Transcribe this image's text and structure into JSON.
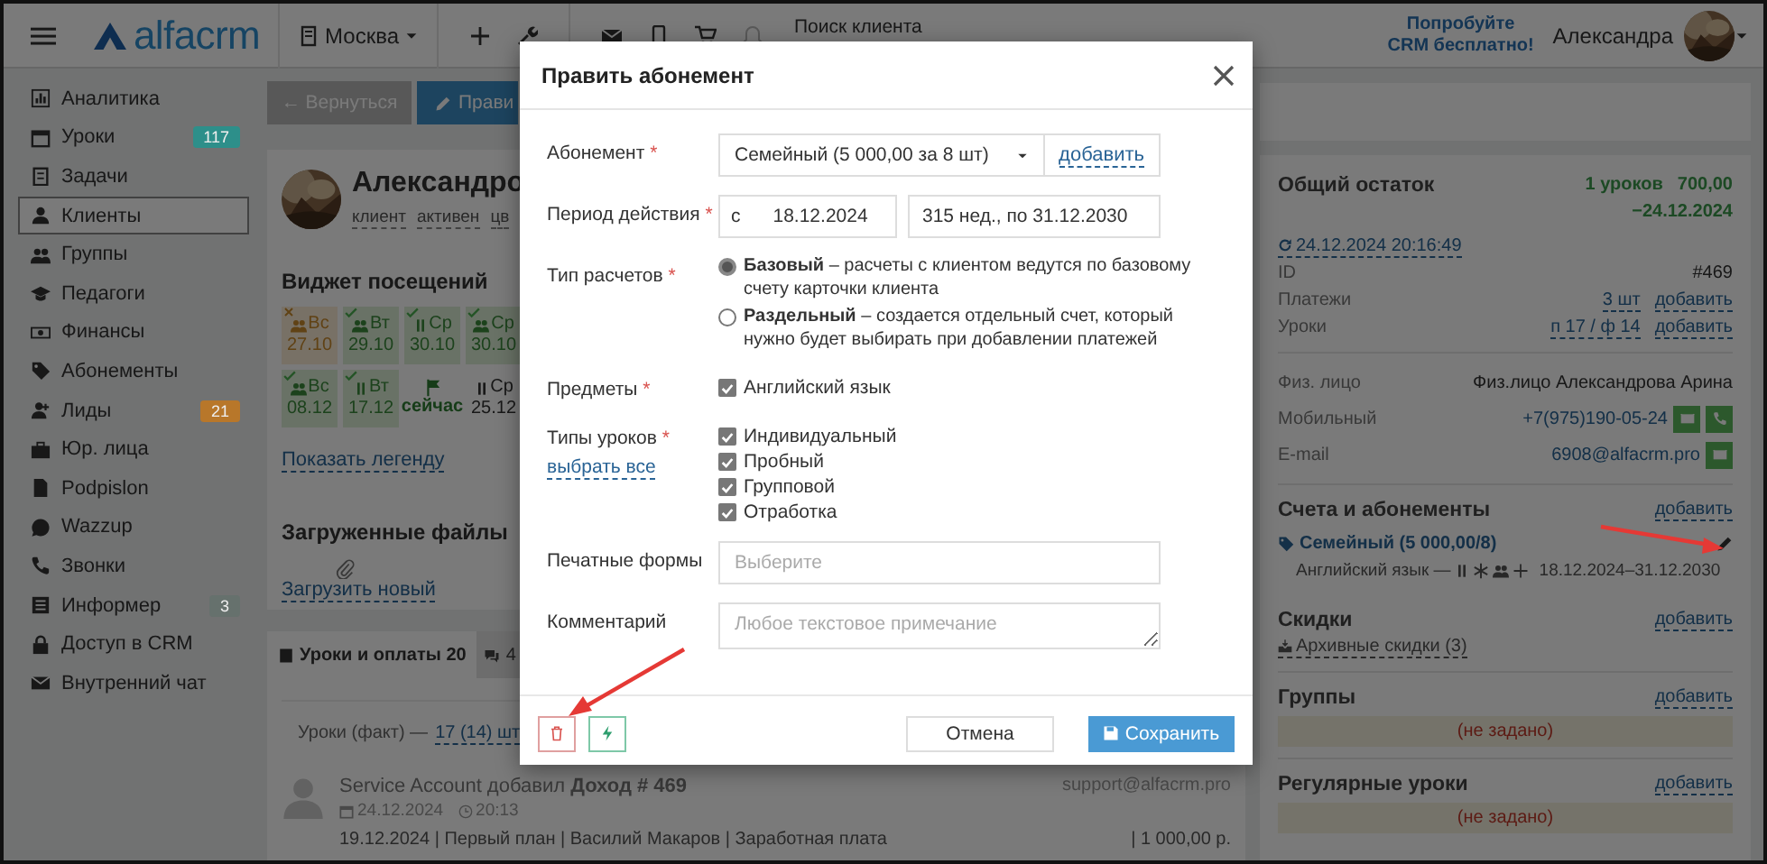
{
  "header": {
    "logo": "alfacrm",
    "city": "Москва",
    "search": {
      "placeholder": "Поиск клиента"
    },
    "promo": "Попробуйте CRM бесплатно!",
    "user": "Александра"
  },
  "sidebar": [
    {
      "label": "Аналитика",
      "selected": false
    },
    {
      "label": "Уроки",
      "selected": false,
      "badge": "117",
      "color": "#2d8f8a"
    },
    {
      "label": "Задачи",
      "selected": false
    },
    {
      "label": "Клиенты",
      "selected": true
    },
    {
      "label": "Группы",
      "selected": false
    },
    {
      "label": "Педагоги",
      "selected": false
    },
    {
      "label": "Финансы",
      "selected": false
    },
    {
      "label": "Абонементы",
      "selected": false
    },
    {
      "label": "Лиды",
      "selected": false,
      "badge": "21",
      "color": "#b8772a"
    },
    {
      "label": "Юр. лица",
      "selected": false
    },
    {
      "label": "Podpislon",
      "selected": false
    },
    {
      "label": "Wazzup",
      "selected": false
    },
    {
      "label": "Звонки",
      "selected": false
    },
    {
      "label": "Информер",
      "selected": false,
      "badge": "3",
      "color": "#66716d"
    },
    {
      "label": "Доступ в CRM",
      "selected": false
    },
    {
      "label": "Внутренний чат",
      "selected": false
    }
  ],
  "toolbar": {
    "back": "← Вернуться",
    "edit": "Прави"
  },
  "client": {
    "name": "Александро",
    "tags": [
      "клиент",
      "активен",
      "цв"
    ]
  },
  "visits": {
    "title": "Виджет посещений",
    "legend": "Показать легенду",
    "cells": [
      {
        "kind": "missed",
        "group": true,
        "day": "Вс",
        "date": "27.10"
      },
      {
        "kind": "done",
        "group": true,
        "day": "Вт",
        "date": "29.10"
      },
      {
        "kind": "done",
        "group": false,
        "day": "Ср",
        "date": "30.10"
      },
      {
        "kind": "done",
        "group": true,
        "day": "Ср",
        "date": "30.10"
      },
      {
        "kind": "done",
        "group": true,
        "day": "Вс",
        "date": "08.12"
      },
      {
        "kind": "done",
        "group": false,
        "day": "Вт",
        "date": "17.12"
      },
      {
        "kind": "now",
        "label": "сейчас"
      },
      {
        "kind": "planned",
        "group": false,
        "day": "Ср",
        "date": "25.12"
      }
    ]
  },
  "files": {
    "title": "Загруженные файлы",
    "upload": "Загрузить новый"
  },
  "tabs": [
    {
      "label": "Уроки и оплаты 20",
      "selected": true
    },
    {
      "label": "4",
      "selected": false
    }
  ],
  "lessons_summary": {
    "label": "Уроки (факт) —",
    "value": "17 (14) шт"
  },
  "feed": [
    {
      "text": "Service Account добавил **Доход # 469**",
      "date": "24.12.2024",
      "time": "20:13",
      "email": "support@alfacrm.pro",
      "details": "19.12.2024 | Первый план | Василий Макаров | Заработная плата",
      "amount": "| 1 000,00 р."
    }
  ],
  "balance": {
    "title": "Общий остаток",
    "lessons": "1 уроков",
    "amount": "700,00",
    "until": "−24.12.2024",
    "synced": "24.12.2024 20:16:49",
    "rows": [
      {
        "label": "ID",
        "value": "#469",
        "link": false
      },
      {
        "label": "Платежи",
        "value": "3 шт",
        "link": true,
        "action": "добавить"
      },
      {
        "label": "Уроки",
        "value": "п 17 / ф 14",
        "link": true,
        "action": "добавить"
      }
    ],
    "contacts": [
      {
        "kind": "text",
        "label": "Физ. лицо",
        "value": "Физ.лицо Александрова Арина"
      },
      {
        "kind": "phone",
        "label": "Мобильный",
        "value": "+7(975)190-05-24"
      },
      {
        "kind": "email",
        "label": "E-mail",
        "value": "6908@alfacrm.pro"
      }
    ]
  },
  "accounts": {
    "title": "Счета и абонементы",
    "action": "добавить",
    "items": [
      {
        "name": "Семейный (5 000,00/8)",
        "subject": "Английский язык —",
        "period": "18.12.2024–31.12.2030"
      }
    ]
  },
  "discounts": {
    "title": "Скидки",
    "action": "добавить",
    "archive": "Архивные скидки (3)"
  },
  "sections": [
    {
      "title": "Группы",
      "action": "добавить",
      "empty": "(не задано)"
    },
    {
      "title": "Регулярные уроки",
      "action": "добавить",
      "empty": "(не задано)"
    }
  ],
  "modal": {
    "title": "Править абонемент",
    "cancel": "Отмена",
    "save": "Сохранить",
    "fields": [
      {
        "kind": "select",
        "label": "Абонемент",
        "mark": "*",
        "value": "Семейный (5 000,00 за 8 шт)",
        "action": "добавить"
      },
      {
        "kind": "period",
        "label": "Период действия",
        "mark": "*",
        "prefix": "с",
        "from": "18.12.2024",
        "to": "315 нед., по 31.12.2030"
      },
      {
        "kind": "radios",
        "label": "Тип расчетов",
        "mark": "*",
        "options": [
          {
            "text": "**Базовый** – расчеты с клиентом ведутся по базовому счету карточки клиента",
            "selected": true
          },
          {
            "text": "**Раздельный** – создается отдельный счет, который нужно будет выбирать при добавлении платежей",
            "selected": false
          }
        ]
      },
      {
        "kind": "checks",
        "label": "Предметы",
        "mark": "*",
        "options": [
          {
            "text": "Английский язык",
            "checked": true
          }
        ]
      },
      {
        "kind": "checks",
        "label": "Типы уроков",
        "mark": "*",
        "link": "выбрать все",
        "options": [
          {
            "text": "Индивидуальный",
            "checked": true
          },
          {
            "text": "Пробный",
            "checked": true
          },
          {
            "text": "Групповой",
            "checked": true
          },
          {
            "text": "Отработка",
            "checked": true
          }
        ]
      },
      {
        "kind": "input",
        "label": "Печатные формы",
        "placeholder": "Выберите"
      },
      {
        "kind": "textarea",
        "label": "Комментарий",
        "placeholder": "Любое текстовое примечание"
      }
    ]
  }
}
